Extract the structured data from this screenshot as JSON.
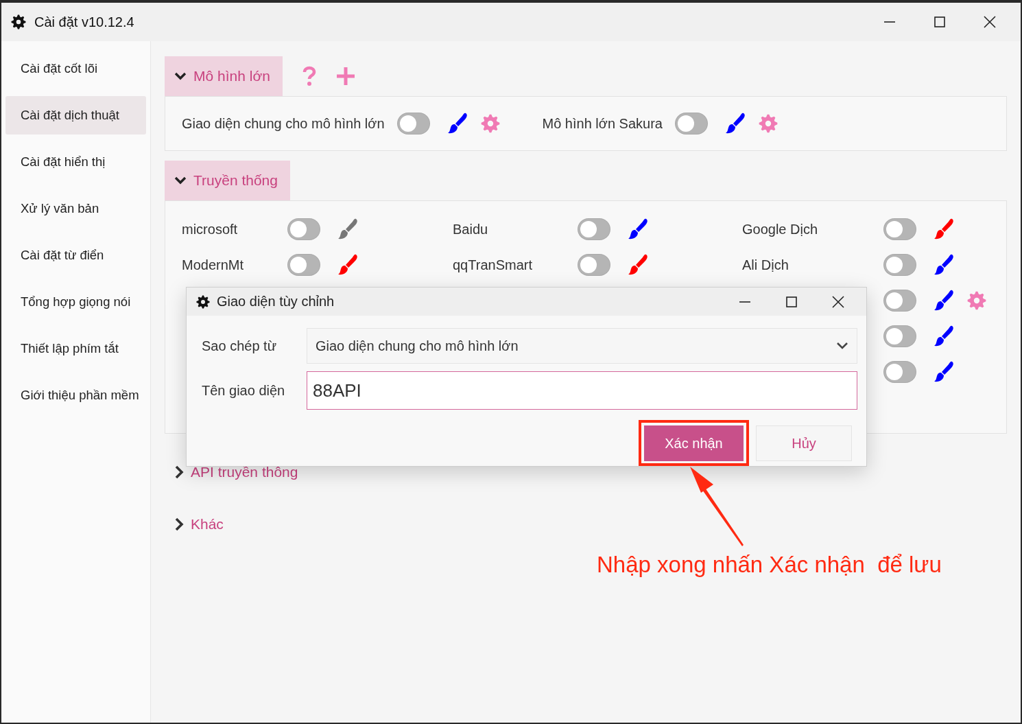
{
  "window": {
    "title": "Cài đặt v10.12.4"
  },
  "sidebar": {
    "items": [
      {
        "label": "Cài đặt cốt lõi",
        "selected": false
      },
      {
        "label": "Cài đặt dịch thuật",
        "selected": true
      },
      {
        "label": "Cài đặt hiển thị",
        "selected": false
      },
      {
        "label": "Xử lý văn bản",
        "selected": false
      },
      {
        "label": "Cài đặt từ điển",
        "selected": false
      },
      {
        "label": "Tổng hợp giọng nói",
        "selected": false
      },
      {
        "label": "Thiết lập phím tắt",
        "selected": false
      },
      {
        "label": "Giới thiệu phần mềm",
        "selected": false
      }
    ]
  },
  "sections": [
    {
      "title": "Mô hình lớn",
      "expanded": true,
      "kind": "inline",
      "actions": [
        {
          "kind": "help"
        },
        {
          "kind": "add"
        }
      ],
      "rows": [
        [
          {
            "name": "Giao diện chung cho mô hình lớn",
            "on": false,
            "color": "#0000ff",
            "settings": true
          },
          {
            "name": "Mô hình lớn Sakura",
            "on": false,
            "color": "#0000ff",
            "settings": true
          }
        ]
      ]
    },
    {
      "title": "Truyền thống",
      "expanded": true,
      "kind": "grid",
      "rows": [
        [
          {
            "name": "microsoft",
            "on": false,
            "color": "#777777",
            "settings": false
          },
          {
            "name": "Baidu",
            "on": false,
            "color": "#0000ff",
            "settings": false
          },
          {
            "name": "Google Dịch",
            "on": false,
            "color": "#ff0000",
            "settings": false
          }
        ],
        [
          {
            "name": "ModernMt",
            "on": false,
            "color": "#ff0000",
            "settings": false
          },
          {
            "name": "qqTranSmart",
            "on": false,
            "color": "#ff0000",
            "settings": false
          },
          {
            "name": "Ali Dịch",
            "on": false,
            "color": "#0000ff",
            "settings": false
          }
        ],
        [
          {
            "on": false,
            "color": "#0000ff",
            "settings": true
          }
        ],
        [
          {
            "on": false,
            "color": "#0000ff",
            "settings": false
          }
        ],
        [
          {
            "on": false,
            "color": "#0000ff",
            "settings": false
          }
        ]
      ]
    },
    {
      "title": "API truyền thông",
      "expanded": false
    },
    {
      "title": "Khác",
      "expanded": false
    }
  ],
  "dialog": {
    "title": "Giao diện tùy chỉnh",
    "fields": [
      {
        "kind": "select",
        "label": "Sao chép từ",
        "value": "Giao diện chung cho mô hình lớn"
      },
      {
        "kind": "text",
        "label": "Tên giao diện",
        "value": "88API"
      }
    ],
    "buttons": [
      {
        "label": "Xác nhận",
        "kind": "primary",
        "highlighted": true
      },
      {
        "label": "Hủy",
        "kind": "secondary",
        "highlighted": false
      }
    ]
  },
  "annotation": {
    "text": "Nhập xong nhấn Xác nhận  để lưu"
  }
}
